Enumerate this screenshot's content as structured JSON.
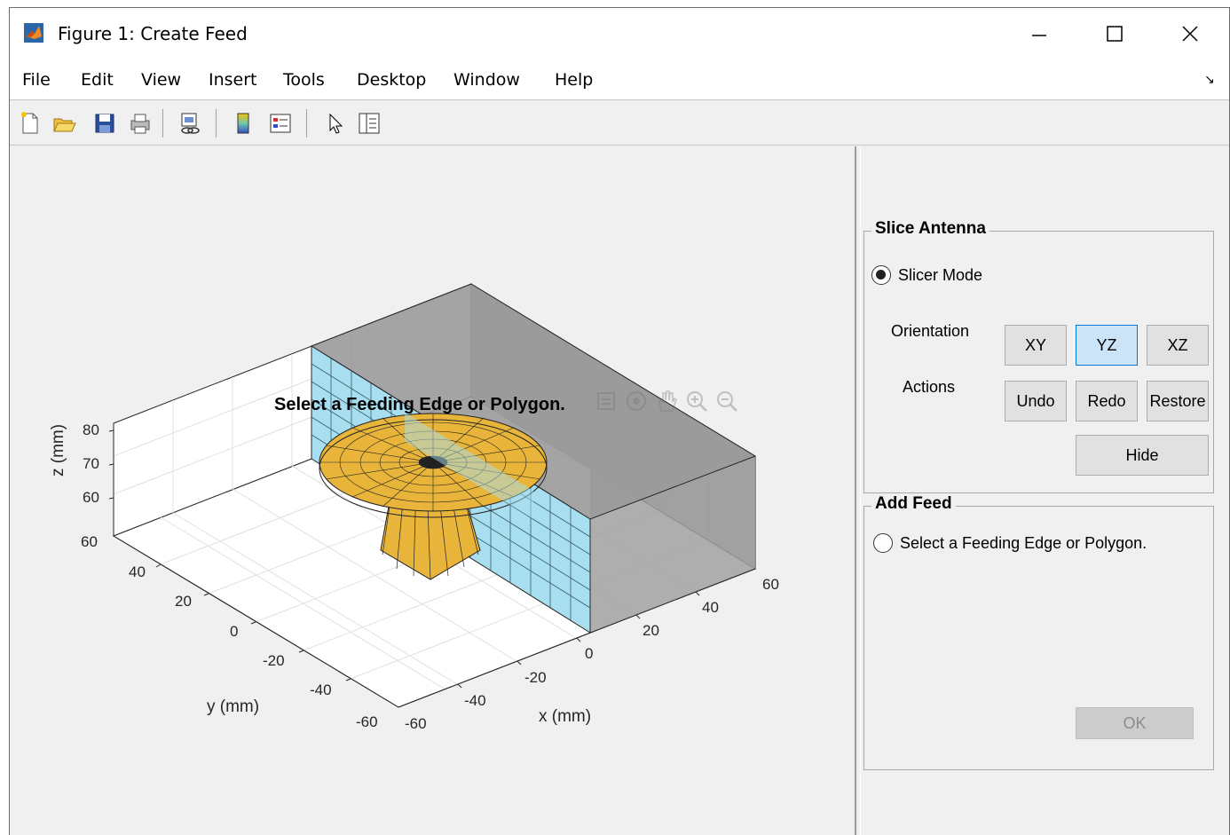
{
  "window": {
    "title": "Figure 1: Create Feed"
  },
  "menu": [
    "File",
    "Edit",
    "View",
    "Insert",
    "Tools",
    "Desktop",
    "Window",
    "Help"
  ],
  "toolbar_icons": [
    "new-figure-icon",
    "open-file-icon",
    "save-icon",
    "print-icon",
    "link-plot-icon",
    "colorbar-icon",
    "legend-icon",
    "pointer-icon",
    "property-inspector-icon"
  ],
  "plot": {
    "title": "Select a Feeding Edge or Polygon.",
    "xlabel": "x (mm)",
    "ylabel": "y (mm)",
    "zlabel": "z (mm)",
    "x_ticks": [
      "-60",
      "-40",
      "-20",
      "0",
      "20",
      "40",
      "60"
    ],
    "y_ticks": [
      "-60",
      "-40",
      "-20",
      "0",
      "20",
      "40",
      "60"
    ],
    "z_ticks": [
      "60",
      "70",
      "80"
    ],
    "colors": {
      "antenna": "#e8b53a",
      "slice_plane": "#a8dff0",
      "gray_plane": "#a0a0a0"
    }
  },
  "slice_panel": {
    "title": "Slice Antenna",
    "slicer_mode": "Slicer Mode",
    "orientation_label": "Orientation",
    "actions_label": "Actions",
    "orientation_buttons": [
      "XY",
      "YZ",
      "XZ"
    ],
    "selected_orientation": "YZ",
    "action_buttons": [
      "Undo",
      "Redo",
      "Restore"
    ],
    "hide_label": "Hide"
  },
  "feed_panel": {
    "title": "Add Feed",
    "option": "Select a Feeding Edge or Polygon.",
    "ok_label": "OK"
  }
}
